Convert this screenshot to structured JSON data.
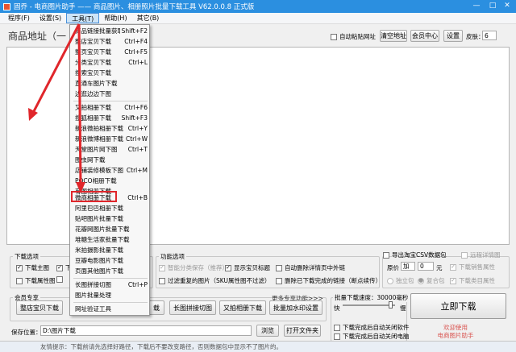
{
  "window": {
    "title": "固乔 - 电商图片助手 —— 商品图片、相册照片批量下载工具 V62.0.0.8 正式版",
    "min": "—",
    "max": "□",
    "close": "✕"
  },
  "menu": {
    "items": [
      "程序(F)",
      "设置(S)",
      "工具(T)",
      "帮助(H)",
      "其它(B)"
    ]
  },
  "top": {
    "url_label": "商品地址（一",
    "auto_paste": "自动粘贴网址",
    "clear": "清空地址",
    "member": "会员中心",
    "settings": "设置",
    "skin_label": "皮肤：",
    "skin_value": "6"
  },
  "dropdown": {
    "items": [
      {
        "label": "商品链接批量获取",
        "shortcut": "Shift+F2"
      },
      {
        "label": "整店宝贝下载",
        "shortcut": "Ctrl+F4"
      },
      {
        "label": "整页宝贝下载",
        "shortcut": "Ctrl+F5"
      },
      {
        "label": "分类宝贝下载",
        "shortcut": "Ctrl+L"
      },
      {
        "label": "搜索宝贝下载",
        "shortcut": ""
      },
      {
        "label": "直通车图片下载",
        "shortcut": ""
      },
      {
        "label": "边逛边边下图",
        "shortcut": ""
      },
      {
        "label": "又拍相册下载",
        "shortcut": "Ctrl+F6"
      },
      {
        "label": "搜狐相册下载",
        "shortcut": "Shift+F3"
      },
      {
        "label": "新浪微拍相册下载",
        "shortcut": "Ctrl+Y"
      },
      {
        "label": "新浪微博相册下载",
        "shortcut": "Ctrl+W"
      },
      {
        "label": "天堂图片网下图",
        "shortcut": "Ctrl+T"
      },
      {
        "label": "图虫网下载",
        "shortcut": ""
      },
      {
        "label": "店铺装修模板下图",
        "shortcut": "Ctrl+M"
      },
      {
        "label": "POCO相册下载",
        "shortcut": ""
      },
      {
        "label": "有图相册下载",
        "shortcut": ""
      },
      {
        "label": "微商相册下载",
        "shortcut": "Ctrl+B"
      },
      {
        "label": "阿里巴巴相册下载",
        "shortcut": ""
      },
      {
        "label": "贴吧图片批量下载",
        "shortcut": ""
      },
      {
        "label": "花瓣网图片批量下载",
        "shortcut": ""
      },
      {
        "label": "堆糖生活家批量下载",
        "shortcut": ""
      },
      {
        "label": "米拍摄影批量下载",
        "shortcut": ""
      },
      {
        "label": "豆瓣电影图片下载",
        "shortcut": ""
      },
      {
        "label": "页面其他图片下载",
        "shortcut": ""
      },
      {
        "label": "长图拼接切图",
        "shortcut": "Ctrl+P"
      },
      {
        "label": "图片批量处理",
        "shortcut": ""
      },
      {
        "label": "网址验证工具",
        "shortcut": ""
      }
    ]
  },
  "download_options": {
    "title": "下载选项",
    "main_image": "下载主图",
    "video": "下载",
    "detail_image": "下载属性图"
  },
  "func_options": {
    "title": "功能选项",
    "smart_save": "智能分类保存（推荐）",
    "show_title": "显示宝贝标题",
    "auto_delete": "自动删除详情页中外链",
    "filter_dup": "过滤重复的图片（SKU属性图不过滤）",
    "delete_shop": "删除已下载完成的链接（断点续传）"
  },
  "export": {
    "csv": "导出淘宝CSV数据包",
    "remote_detail": "远程详情图",
    "price_label": "原价",
    "price_op": "加",
    "price_value": "0",
    "price_unit": "元",
    "sales_attr": "下载销售属性",
    "single_pkg": "独立包",
    "merge_pkg": "复合包",
    "class_attr": "下载类目属性"
  },
  "member_area": {
    "title": "会员专享",
    "btn1": "整店宝贝下载",
    "btn2": "载",
    "btn3": "长图拼接切图",
    "btn4": "又拍相册下载",
    "btn5": "批量加水印设置",
    "more": "更多专享功能>>>"
  },
  "speed": {
    "title": "批量下载速度：",
    "value": "30000毫秒",
    "fast": "快",
    "slow": "慢",
    "auto_close_software": "下载完成后自动关闭软件",
    "auto_close_pc": "下载完成后自动关闭电脑"
  },
  "start_label": "立即下载",
  "welcome": "欢迎使用\n电商图片助手",
  "save": {
    "label": "保存位置：",
    "path": "D:\\图片下载",
    "browse": "浏览",
    "open": "打开文件夹"
  },
  "status": "友情提示：下载前请先选择好路径，下载后不要改变路径，否则数据包中显示不了图片的。",
  "colors": {
    "title_bar": "#2b8fe0",
    "highlight": "#e0262b",
    "arrow": "#e0262b",
    "welcome": "#d9534f"
  }
}
